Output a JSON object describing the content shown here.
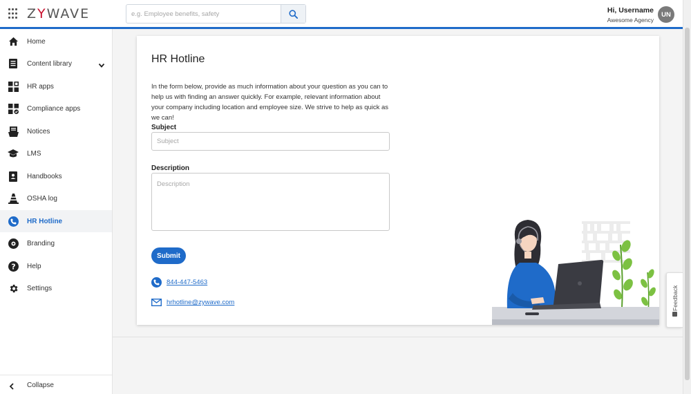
{
  "header": {
    "logo_prefix": "Z",
    "logo_y": "Y",
    "logo_suffix": "WAVE",
    "search_placeholder": "e.g. Employee benefits, safety",
    "greeting": "Hi, Username",
    "agency": "Awesome Agency",
    "avatar_initials": "UN"
  },
  "sidebar": {
    "items": [
      {
        "label": "Home",
        "icon": "home-icon"
      },
      {
        "label": "Content library",
        "icon": "document-list-icon"
      },
      {
        "label": "HR apps",
        "icon": "apps-grid-icon"
      },
      {
        "label": "Compliance apps",
        "icon": "compliance-grid-icon"
      },
      {
        "label": "Notices",
        "icon": "notices-icon"
      },
      {
        "label": "LMS",
        "icon": "graduation-cap-icon"
      },
      {
        "label": "Handbooks",
        "icon": "handbook-icon"
      },
      {
        "label": "OSHA log",
        "icon": "cone-icon"
      },
      {
        "label": "HR Hotline",
        "icon": "phone-icon"
      },
      {
        "label": "Branding",
        "icon": "palette-icon"
      },
      {
        "label": "Help",
        "icon": "help-icon"
      },
      {
        "label": "Settings",
        "icon": "gear-icon"
      }
    ],
    "active_item": "HR Hotline",
    "collapse_label": "Collapse"
  },
  "card": {
    "title": "HR Hotline",
    "description": "In the form below, provide as much information about your question as you can to help us with finding an answer quickly. For example, relevant information about your company including location and employee size. We strive to help as quick as we can!",
    "subject_label": "Subject",
    "subject_placeholder": "Subject",
    "description_label": "Description",
    "description_placeholder": "Description",
    "submit_label": "Submit",
    "phone": "844-447-5463",
    "email": "hrhotline@zywave.com"
  },
  "feedback_label": "Feedback",
  "colors": {
    "accent": "#1f6bc9",
    "logo_accent": "#c8102e"
  }
}
